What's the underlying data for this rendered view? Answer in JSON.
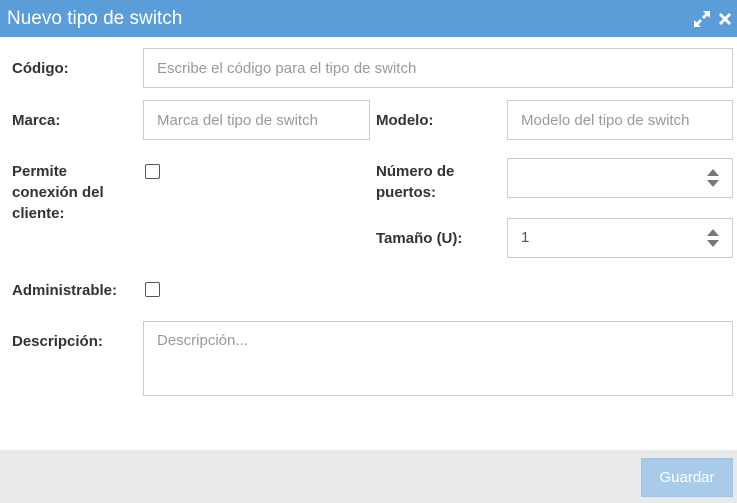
{
  "dialog": {
    "title": "Nuevo tipo de switch",
    "icons": {
      "maximize": "expand-arrows-icon",
      "close": "close-x-icon"
    }
  },
  "form": {
    "codigo": {
      "label": "Código:",
      "placeholder": "Escribe el código para el tipo de switch",
      "value": ""
    },
    "marca": {
      "label": "Marca:",
      "placeholder": "Marca del tipo de switch",
      "value": ""
    },
    "modelo": {
      "label": "Modelo:",
      "placeholder": "Modelo del tipo de switch",
      "value": ""
    },
    "permite_conexion": {
      "label_line1": "Permite",
      "label_line2": "conexión del",
      "label_line3": "cliente:",
      "checked": false
    },
    "numero_puertos": {
      "label_line1": "Número de",
      "label_line2": "puertos:",
      "value": ""
    },
    "tamano": {
      "label": "Tamaño (U):",
      "value": "1"
    },
    "administrable": {
      "label": "Administrable:",
      "checked": false
    },
    "descripcion": {
      "label": "Descripción:",
      "placeholder": "Descripción...",
      "value": ""
    }
  },
  "footer": {
    "save_label": "Guardar"
  },
  "colors": {
    "titlebar": "#5b9dd9",
    "save_button": "#a9cbea",
    "footer": "#e9e9e9"
  }
}
